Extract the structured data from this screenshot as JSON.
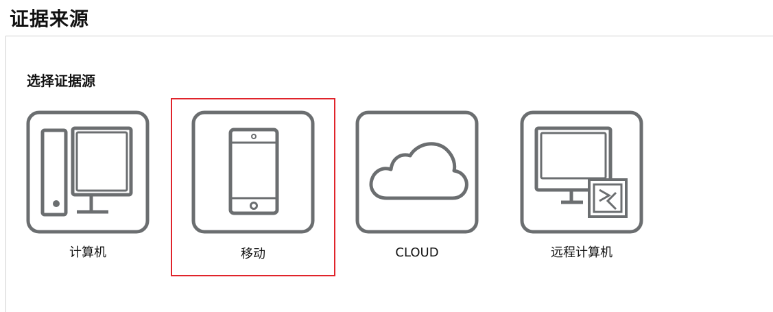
{
  "page": {
    "title": "证据来源"
  },
  "section": {
    "title": "选择证据源"
  },
  "sources": [
    {
      "label": "计算机",
      "icon": "computer-icon",
      "selected": false
    },
    {
      "label": "移动",
      "icon": "mobile-phone-icon",
      "selected": true
    },
    {
      "label": "CLOUD",
      "icon": "cloud-icon",
      "selected": false
    },
    {
      "label": "远程计算机",
      "icon": "remote-computer-icon",
      "selected": false
    }
  ],
  "colors": {
    "icon_stroke": "#6b6e70",
    "selection_border": "#e0242b",
    "divider": "#cfcfcf"
  }
}
